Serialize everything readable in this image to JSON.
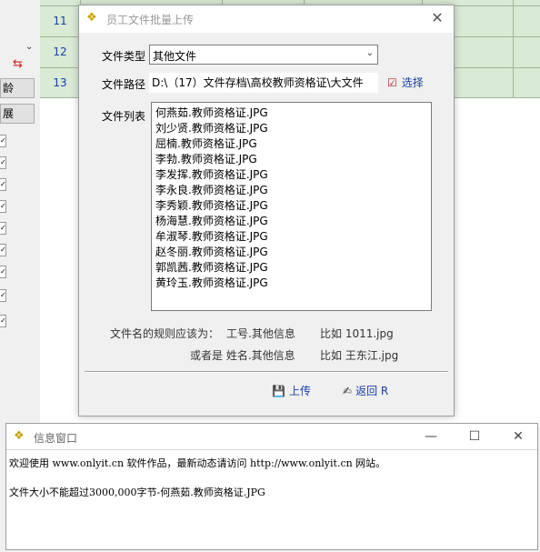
{
  "background": {
    "row_numbers": [
      "11",
      "12",
      "13"
    ],
    "buttons": [
      "龄",
      "展"
    ]
  },
  "dialog": {
    "title": "员工文件批量上传",
    "file_type_label": "文件类型",
    "file_type_value": "其他文件",
    "file_path_label": "文件路径",
    "file_path_value": "D:\\（17）文件存档\\高校教师资格证\\大文件",
    "select_button": "选择",
    "file_list_label": "文件列表",
    "files": [
      "何燕茹.教师资格证.JPG",
      "刘少贤.教师资格证.JPG",
      "屈楠.教师资格证.JPG",
      "李勃.教师资格证.JPG",
      "李发挥.教师资格证.JPG",
      "李永良.教师资格证.JPG",
      "李秀颖.教师资格证.JPG",
      "杨海慧.教师资格证.JPG",
      "牟淑琴.教师资格证.JPG",
      "赵冬丽.教师资格证.JPG",
      "郭凯茜.教师资格证.JPG",
      "黄玲玉.教师资格证.JPG"
    ],
    "rule_prefix": "文件名的规则应该为：",
    "rule1": "工号.其他信息",
    "rule1_example": "比如 1011.jpg",
    "rule2": "或者是 姓名.其他信息",
    "rule2_example": "比如 王东江.jpg",
    "upload_button": "上传",
    "back_button": "返回 R"
  },
  "info_window": {
    "title": "信息窗口",
    "line1": "欢迎使用 www.onlyit.cn 软件作品，最新动态请访问 http://www.onlyit.cn 网站。",
    "line2": "文件大小不能超过3000,000字节-何燕茹.教师资格证.JPG"
  }
}
